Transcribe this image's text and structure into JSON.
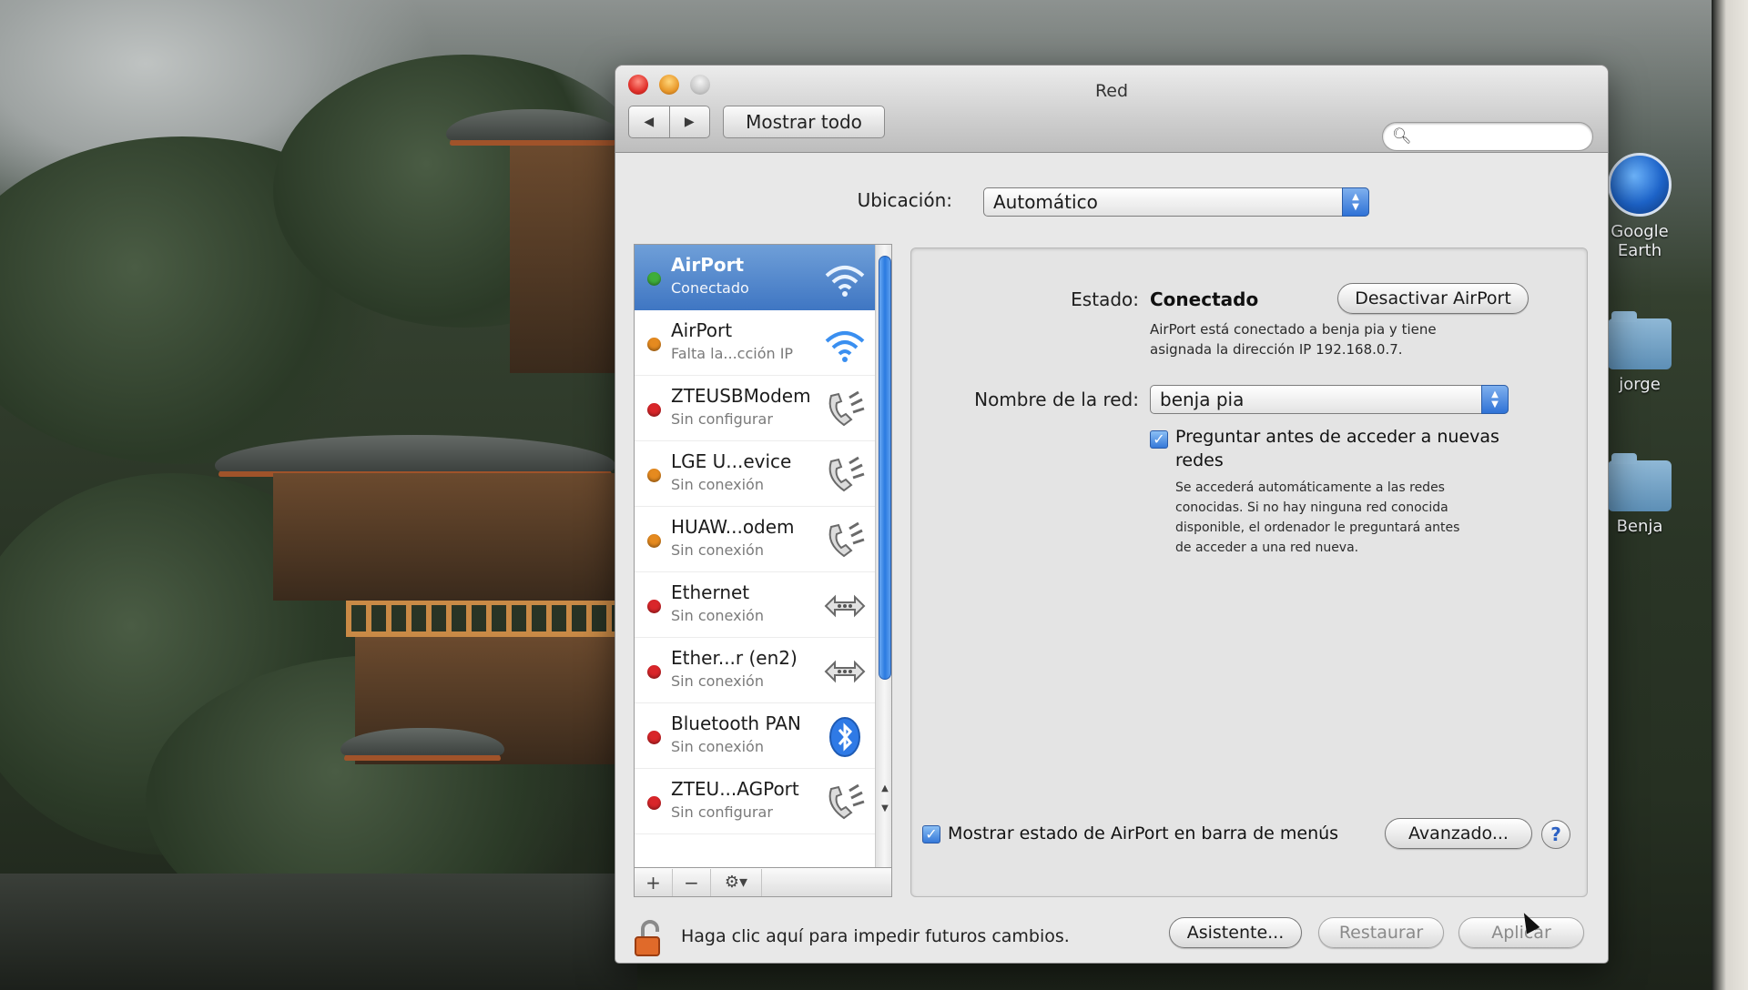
{
  "desktop": {
    "icons": [
      {
        "label": "Google\nEarth",
        "icon": "google-earth-icon"
      },
      {
        "label": "jorge",
        "icon": "folder-icon"
      },
      {
        "label": "Benja",
        "icon": "folder-icon"
      }
    ]
  },
  "window": {
    "title": "Red",
    "toolbar": {
      "back_icon": "back-arrow-icon",
      "forward_icon": "forward-arrow-icon",
      "show_all_label": "Mostrar todo",
      "search_placeholder": ""
    },
    "location": {
      "label": "Ubicación:",
      "value": "Automático"
    },
    "services": [
      {
        "name": "AirPort",
        "status": "Conectado",
        "dot": "#3fae3a",
        "icon": "wifi-icon",
        "selected": true
      },
      {
        "name": "AirPort",
        "status": "Falta la...cción IP",
        "dot": "#e58a1f",
        "icon": "wifi-icon"
      },
      {
        "name": "ZTEUSBModem",
        "status": "Sin configurar",
        "dot": "#d9262a",
        "icon": "phone-icon"
      },
      {
        "name": "LGE U...evice",
        "status": "Sin conexión",
        "dot": "#e58a1f",
        "icon": "phone-icon"
      },
      {
        "name": "HUAW...odem",
        "status": "Sin conexión",
        "dot": "#e58a1f",
        "icon": "phone-icon"
      },
      {
        "name": "Ethernet",
        "status": "Sin conexión",
        "dot": "#d9262a",
        "icon": "ethernet-icon"
      },
      {
        "name": "Ether...r (en2)",
        "status": "Sin conexión",
        "dot": "#d9262a",
        "icon": "ethernet-icon"
      },
      {
        "name": "Bluetooth PAN",
        "status": "Sin conexión",
        "dot": "#d9262a",
        "icon": "bluetooth-icon"
      },
      {
        "name": "ZTEU...AGPort",
        "status": "Sin configurar",
        "dot": "#d9262a",
        "icon": "phone-icon"
      }
    ],
    "list_toolbar": {
      "add_label": "+",
      "remove_label": "−",
      "gear_label": "⚙▾"
    },
    "detail": {
      "status_label": "Estado:",
      "status_value": "Conectado",
      "toggle_button": "Desactivar AirPort",
      "status_description": "AirPort  está conectado a benja pia y tiene\nasignada la dirección IP 192.168.0.7.",
      "network_label": "Nombre de la red:",
      "network_value": "benja pia",
      "ask_checkbox_label": "Preguntar antes de acceder a nuevas\nredes",
      "ask_checkbox_checked": true,
      "ask_description": "Se accederá automáticamente a las redes\nconocidas. Si no hay ninguna red conocida\ndisponible, el ordenador le preguntará antes\nde acceder a una red nueva.",
      "menubar_checkbox_label": "Mostrar estado de AirPort en barra de menús",
      "menubar_checkbox_checked": true,
      "advanced_button": "Avanzado...",
      "help_button": "?"
    },
    "footer": {
      "lock_text": "Haga clic aquí para impedir futuros cambios.",
      "assistant_button": "Asistente...",
      "restore_button": "Restaurar",
      "apply_button": "Aplicar"
    }
  }
}
